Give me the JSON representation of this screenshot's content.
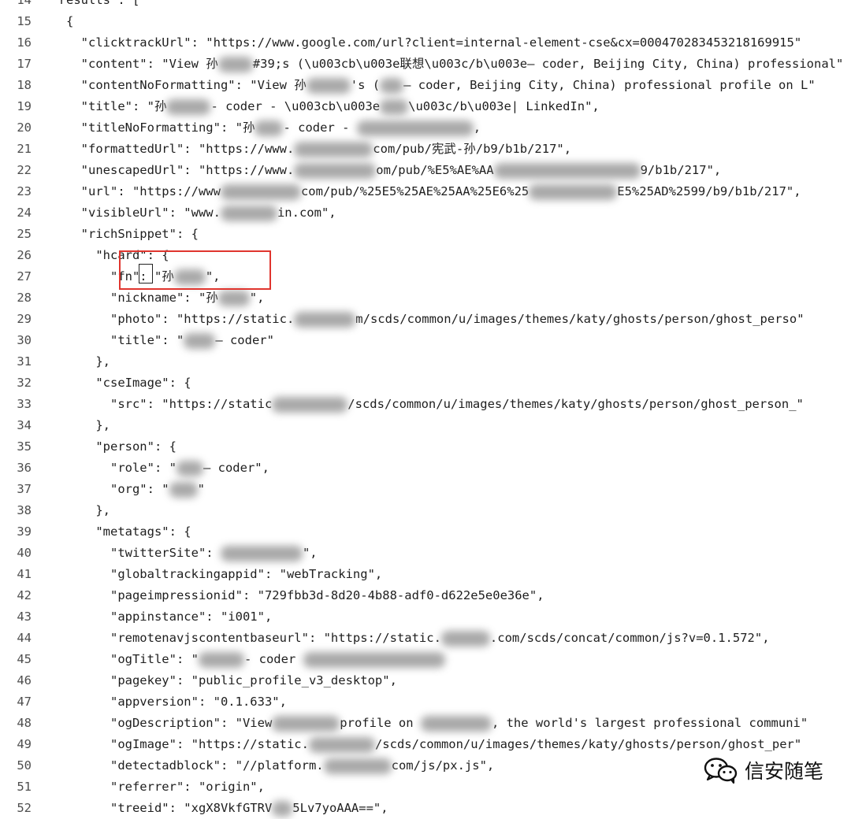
{
  "editor": {
    "lines": [
      {
        "num": "14",
        "segments": [
          {
            "t": "    \"results\": ["
          }
        ]
      },
      {
        "num": "15",
        "segments": [
          {
            "t": "      {"
          }
        ]
      },
      {
        "num": "16",
        "segments": [
          {
            "t": "        \"clicktrackUrl\": \"https://www.google.com/url?client=internal-element-cse&cx=000470283453218169915\""
          }
        ]
      },
      {
        "num": "17",
        "segments": [
          {
            "t": "        \"content\": \"View 孙"
          },
          {
            "blur": 44
          },
          {
            "t": "#39;s (\\u003cb\\u003e联想\\u003c/b\\u003e— coder, Beijing City, China) professional\""
          }
        ]
      },
      {
        "num": "18",
        "segments": [
          {
            "t": "        \"contentNoFormatting\": \"View 孙"
          },
          {
            "blur": 56
          },
          {
            "t": "'s ("
          },
          {
            "blur": 30
          },
          {
            "t": "— coder, Beijing City, China) professional profile on L\""
          }
        ]
      },
      {
        "num": "19",
        "segments": [
          {
            "t": "        \"title\": \"孙"
          },
          {
            "blur": 56
          },
          {
            "t": "- coder - \\u003cb\\u003e"
          },
          {
            "blur": 36
          },
          {
            "t": "\\u003c/b\\u003e| LinkedIn\","
          }
        ]
      },
      {
        "num": "20",
        "segments": [
          {
            "t": "        \"titleNoFormatting\": \"孙"
          },
          {
            "blur": 36
          },
          {
            "t": "- coder - "
          },
          {
            "blur": 148
          },
          {
            "t": ","
          }
        ]
      },
      {
        "num": "21",
        "segments": [
          {
            "t": "        \"formattedUrl\": \"https://www."
          },
          {
            "blur": 100
          },
          {
            "t": "com/pub/宪武-孙/b9/b1b/217\","
          }
        ]
      },
      {
        "num": "22",
        "segments": [
          {
            "t": "        \"unescapedUrl\": \"https://www."
          },
          {
            "blur": 104
          },
          {
            "t": "om/pub/%E5%AE%AA"
          },
          {
            "blur": 186
          },
          {
            "t": "9/b1b/217\","
          }
        ]
      },
      {
        "num": "23",
        "segments": [
          {
            "t": "        \"url\": \"https://www"
          },
          {
            "blur": 102
          },
          {
            "t": "com/pub/%25E5%25AE%25AA%25E6%25"
          },
          {
            "blur": 112
          },
          {
            "t": "E5%25AD%2599/b9/b1b/217\","
          }
        ]
      },
      {
        "num": "24",
        "segments": [
          {
            "t": "        \"visibleUrl\": \"www."
          },
          {
            "blur": 72
          },
          {
            "t": "in.com\","
          }
        ]
      },
      {
        "num": "25",
        "segments": [
          {
            "t": "        \"richSnippet\": {"
          }
        ]
      },
      {
        "num": "26",
        "segments": [
          {
            "t": "          \"hcard\": {"
          }
        ]
      },
      {
        "num": "27",
        "segments": [
          {
            "t": "            \"fn\": \"孙"
          },
          {
            "blur": 40
          },
          {
            "t": "\","
          }
        ]
      },
      {
        "num": "28",
        "segments": [
          {
            "t": "            \"nickname\": \"孙"
          },
          {
            "blur": 40
          },
          {
            "t": "\","
          }
        ]
      },
      {
        "num": "29",
        "segments": [
          {
            "t": "            \"photo\": \"https://static."
          },
          {
            "blur": 78
          },
          {
            "t": "m/scds/common/u/images/themes/katy/ghosts/person/ghost_perso\""
          }
        ]
      },
      {
        "num": "30",
        "segments": [
          {
            "t": "            \"title\": \""
          },
          {
            "blur": 40
          },
          {
            "t": "— coder\""
          }
        ]
      },
      {
        "num": "31",
        "segments": [
          {
            "t": "          },"
          }
        ]
      },
      {
        "num": "32",
        "segments": [
          {
            "t": "          \"cseImage\": {"
          }
        ]
      },
      {
        "num": "33",
        "segments": [
          {
            "t": "            \"src\": \"https://static"
          },
          {
            "blur": 96
          },
          {
            "t": "/scds/common/u/images/themes/katy/ghosts/person/ghost_person_\""
          }
        ]
      },
      {
        "num": "34",
        "segments": [
          {
            "t": "          },"
          }
        ]
      },
      {
        "num": "35",
        "segments": [
          {
            "t": "          \"person\": {"
          }
        ]
      },
      {
        "num": "36",
        "segments": [
          {
            "t": "            \"role\": \""
          },
          {
            "blur": 34
          },
          {
            "t": "— coder\","
          }
        ]
      },
      {
        "num": "37",
        "segments": [
          {
            "t": "            \"org\": \""
          },
          {
            "blur": 36
          },
          {
            "t": "\""
          }
        ]
      },
      {
        "num": "38",
        "segments": [
          {
            "t": "          },"
          }
        ]
      },
      {
        "num": "39",
        "segments": [
          {
            "t": "          \"metatags\": {"
          }
        ]
      },
      {
        "num": "40",
        "segments": [
          {
            "t": "            \"twitterSite\": "
          },
          {
            "blur": 104
          },
          {
            "t": "\","
          }
        ]
      },
      {
        "num": "41",
        "segments": [
          {
            "t": "            \"globaltrackingappid\": \"webTracking\","
          }
        ]
      },
      {
        "num": "42",
        "segments": [
          {
            "t": "            \"pageimpressionid\": \"729fbb3d-8d20-4b88-adf0-d622e5e0e36e\","
          }
        ]
      },
      {
        "num": "43",
        "segments": [
          {
            "t": "            \"appinstance\": \"i001\","
          }
        ]
      },
      {
        "num": "44",
        "segments": [
          {
            "t": "            \"remotenavjscontentbaseurl\": \"https://static."
          },
          {
            "blur": 62
          },
          {
            "t": ".com/scds/concat/common/js?v=0.1.572\","
          }
        ]
      },
      {
        "num": "45",
        "segments": [
          {
            "t": "            \"ogTitle\": \""
          },
          {
            "blur": 58
          },
          {
            "t": "- coder "
          },
          {
            "blur": 180
          }
        ]
      },
      {
        "num": "46",
        "segments": [
          {
            "t": "            \"pagekey\": \"public_profile_v3_desktop\","
          }
        ]
      },
      {
        "num": "47",
        "segments": [
          {
            "t": "            \"appversion\": \"0.1.633\","
          }
        ]
      },
      {
        "num": "48",
        "segments": [
          {
            "t": "            \"ogDescription\": \"View"
          },
          {
            "blur": 86
          },
          {
            "t": "profile on "
          },
          {
            "blur": 90
          },
          {
            "t": ", the world's largest professional communi\""
          }
        ]
      },
      {
        "num": "49",
        "segments": [
          {
            "t": "            \"ogImage\": \"https://static."
          },
          {
            "blur": 84
          },
          {
            "t": "/scds/common/u/images/themes/katy/ghosts/person/ghost_per\""
          }
        ]
      },
      {
        "num": "50",
        "segments": [
          {
            "t": "            \"detectadblock\": \"//platform."
          },
          {
            "blur": 86
          },
          {
            "t": "com/js/px.js\","
          }
        ]
      },
      {
        "num": "51",
        "segments": [
          {
            "t": "            \"referrer\": \"origin\","
          }
        ]
      },
      {
        "num": "52",
        "segments": [
          {
            "t": "            \"treeid\": \"xgX8VkfGTRV"
          },
          {
            "blur": 26
          },
          {
            "t": "5Lv7yoAAA==\","
          }
        ]
      }
    ]
  },
  "watermark": {
    "icon": "wechat-icon",
    "text": "信安随笔"
  },
  "colors": {
    "highlight_box": "#e0352e",
    "line_numbers": "#4e4e4e",
    "code_text": "#1e1e1e"
  }
}
